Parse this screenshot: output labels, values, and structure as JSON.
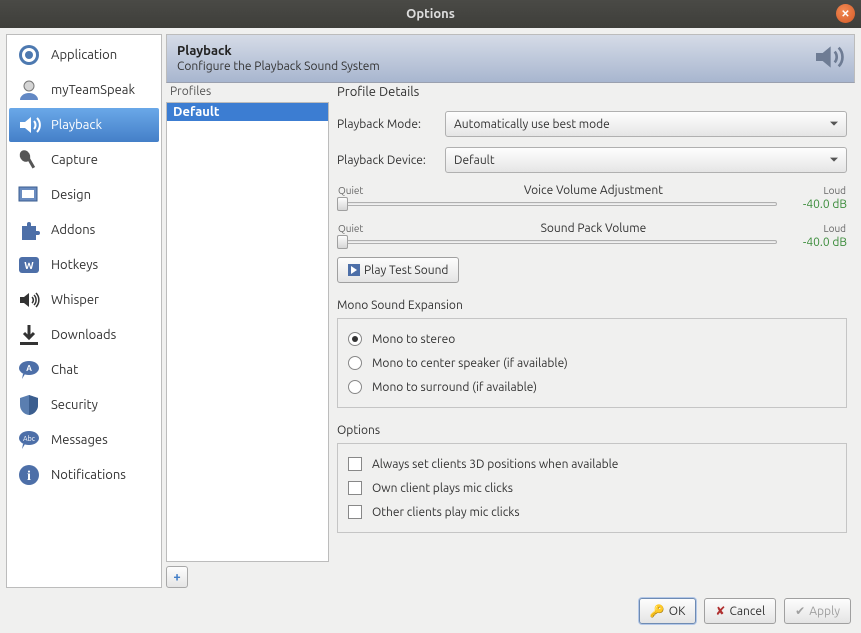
{
  "window": {
    "title": "Options"
  },
  "sidebar": {
    "items": [
      {
        "label": "Application"
      },
      {
        "label": "myTeamSpeak"
      },
      {
        "label": "Playback",
        "selected": true
      },
      {
        "label": "Capture"
      },
      {
        "label": "Design"
      },
      {
        "label": "Addons"
      },
      {
        "label": "Hotkeys"
      },
      {
        "label": "Whisper"
      },
      {
        "label": "Downloads"
      },
      {
        "label": "Chat"
      },
      {
        "label": "Security"
      },
      {
        "label": "Messages"
      },
      {
        "label": "Notifications"
      }
    ]
  },
  "header": {
    "title": "Playback",
    "subtitle": "Configure the Playback Sound System"
  },
  "profiles": {
    "label": "Profiles",
    "items": [
      {
        "label": "Default",
        "selected": true
      }
    ]
  },
  "details": {
    "title": "Profile Details",
    "mode": {
      "label": "Playback Mode:",
      "value": "Automatically use best mode"
    },
    "device": {
      "label": "Playback Device:",
      "value": "Default"
    },
    "voice": {
      "quiet": "Quiet",
      "loud": "Loud",
      "title": "Voice Volume Adjustment",
      "value": "-40.0 dB"
    },
    "pack": {
      "quiet": "Quiet",
      "loud": "Loud",
      "title": "Sound Pack Volume",
      "value": "-40.0 dB"
    },
    "test_button": "Play Test Sound",
    "mono": {
      "title": "Mono Sound Expansion",
      "options": [
        {
          "label": "Mono to stereo",
          "checked": true
        },
        {
          "label": "Mono to center speaker (if available)",
          "checked": false
        },
        {
          "label": "Mono to surround (if available)",
          "checked": false
        }
      ]
    },
    "options": {
      "title": "Options",
      "items": [
        {
          "label": "Always set clients 3D positions when available"
        },
        {
          "label": "Own client plays mic clicks"
        },
        {
          "label": "Other clients play mic clicks"
        }
      ]
    }
  },
  "footer": {
    "ok": "OK",
    "cancel": "Cancel",
    "apply": "Apply"
  }
}
